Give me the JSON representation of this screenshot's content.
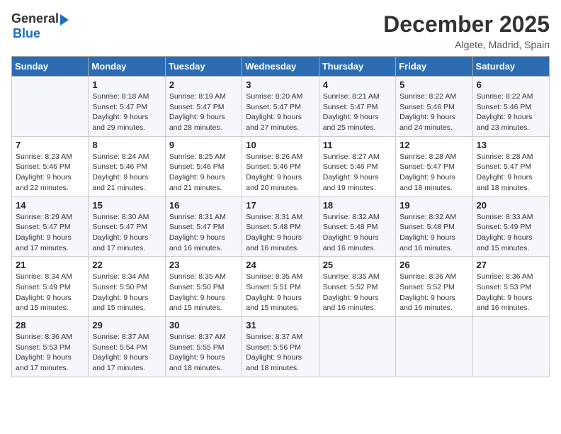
{
  "header": {
    "logo_general": "General",
    "logo_blue": "Blue",
    "month": "December 2025",
    "location": "Algete, Madrid, Spain"
  },
  "weekdays": [
    "Sunday",
    "Monday",
    "Tuesday",
    "Wednesday",
    "Thursday",
    "Friday",
    "Saturday"
  ],
  "weeks": [
    [
      {
        "day": "",
        "info": ""
      },
      {
        "day": "1",
        "info": "Sunrise: 8:18 AM\nSunset: 5:47 PM\nDaylight: 9 hours\nand 29 minutes."
      },
      {
        "day": "2",
        "info": "Sunrise: 8:19 AM\nSunset: 5:47 PM\nDaylight: 9 hours\nand 28 minutes."
      },
      {
        "day": "3",
        "info": "Sunrise: 8:20 AM\nSunset: 5:47 PM\nDaylight: 9 hours\nand 27 minutes."
      },
      {
        "day": "4",
        "info": "Sunrise: 8:21 AM\nSunset: 5:47 PM\nDaylight: 9 hours\nand 25 minutes."
      },
      {
        "day": "5",
        "info": "Sunrise: 8:22 AM\nSunset: 5:46 PM\nDaylight: 9 hours\nand 24 minutes."
      },
      {
        "day": "6",
        "info": "Sunrise: 8:22 AM\nSunset: 5:46 PM\nDaylight: 9 hours\nand 23 minutes."
      }
    ],
    [
      {
        "day": "7",
        "info": "Sunrise: 8:23 AM\nSunset: 5:46 PM\nDaylight: 9 hours\nand 22 minutes."
      },
      {
        "day": "8",
        "info": "Sunrise: 8:24 AM\nSunset: 5:46 PM\nDaylight: 9 hours\nand 21 minutes."
      },
      {
        "day": "9",
        "info": "Sunrise: 8:25 AM\nSunset: 5:46 PM\nDaylight: 9 hours\nand 21 minutes."
      },
      {
        "day": "10",
        "info": "Sunrise: 8:26 AM\nSunset: 5:46 PM\nDaylight: 9 hours\nand 20 minutes."
      },
      {
        "day": "11",
        "info": "Sunrise: 8:27 AM\nSunset: 5:46 PM\nDaylight: 9 hours\nand 19 minutes."
      },
      {
        "day": "12",
        "info": "Sunrise: 8:28 AM\nSunset: 5:47 PM\nDaylight: 9 hours\nand 18 minutes."
      },
      {
        "day": "13",
        "info": "Sunrise: 8:28 AM\nSunset: 5:47 PM\nDaylight: 9 hours\nand 18 minutes."
      }
    ],
    [
      {
        "day": "14",
        "info": "Sunrise: 8:29 AM\nSunset: 5:47 PM\nDaylight: 9 hours\nand 17 minutes."
      },
      {
        "day": "15",
        "info": "Sunrise: 8:30 AM\nSunset: 5:47 PM\nDaylight: 9 hours\nand 17 minutes."
      },
      {
        "day": "16",
        "info": "Sunrise: 8:31 AM\nSunset: 5:47 PM\nDaylight: 9 hours\nand 16 minutes."
      },
      {
        "day": "17",
        "info": "Sunrise: 8:31 AM\nSunset: 5:48 PM\nDaylight: 9 hours\nand 16 minutes."
      },
      {
        "day": "18",
        "info": "Sunrise: 8:32 AM\nSunset: 5:48 PM\nDaylight: 9 hours\nand 16 minutes."
      },
      {
        "day": "19",
        "info": "Sunrise: 8:32 AM\nSunset: 5:48 PM\nDaylight: 9 hours\nand 16 minutes."
      },
      {
        "day": "20",
        "info": "Sunrise: 8:33 AM\nSunset: 5:49 PM\nDaylight: 9 hours\nand 15 minutes."
      }
    ],
    [
      {
        "day": "21",
        "info": "Sunrise: 8:34 AM\nSunset: 5:49 PM\nDaylight: 9 hours\nand 15 minutes."
      },
      {
        "day": "22",
        "info": "Sunrise: 8:34 AM\nSunset: 5:50 PM\nDaylight: 9 hours\nand 15 minutes."
      },
      {
        "day": "23",
        "info": "Sunrise: 8:35 AM\nSunset: 5:50 PM\nDaylight: 9 hours\nand 15 minutes."
      },
      {
        "day": "24",
        "info": "Sunrise: 8:35 AM\nSunset: 5:51 PM\nDaylight: 9 hours\nand 15 minutes."
      },
      {
        "day": "25",
        "info": "Sunrise: 8:35 AM\nSunset: 5:52 PM\nDaylight: 9 hours\nand 16 minutes."
      },
      {
        "day": "26",
        "info": "Sunrise: 8:36 AM\nSunset: 5:52 PM\nDaylight: 9 hours\nand 16 minutes."
      },
      {
        "day": "27",
        "info": "Sunrise: 8:36 AM\nSunset: 5:53 PM\nDaylight: 9 hours\nand 16 minutes."
      }
    ],
    [
      {
        "day": "28",
        "info": "Sunrise: 8:36 AM\nSunset: 5:53 PM\nDaylight: 9 hours\nand 17 minutes."
      },
      {
        "day": "29",
        "info": "Sunrise: 8:37 AM\nSunset: 5:54 PM\nDaylight: 9 hours\nand 17 minutes."
      },
      {
        "day": "30",
        "info": "Sunrise: 8:37 AM\nSunset: 5:55 PM\nDaylight: 9 hours\nand 18 minutes."
      },
      {
        "day": "31",
        "info": "Sunrise: 8:37 AM\nSunset: 5:56 PM\nDaylight: 9 hours\nand 18 minutes."
      },
      {
        "day": "",
        "info": ""
      },
      {
        "day": "",
        "info": ""
      },
      {
        "day": "",
        "info": ""
      }
    ]
  ]
}
